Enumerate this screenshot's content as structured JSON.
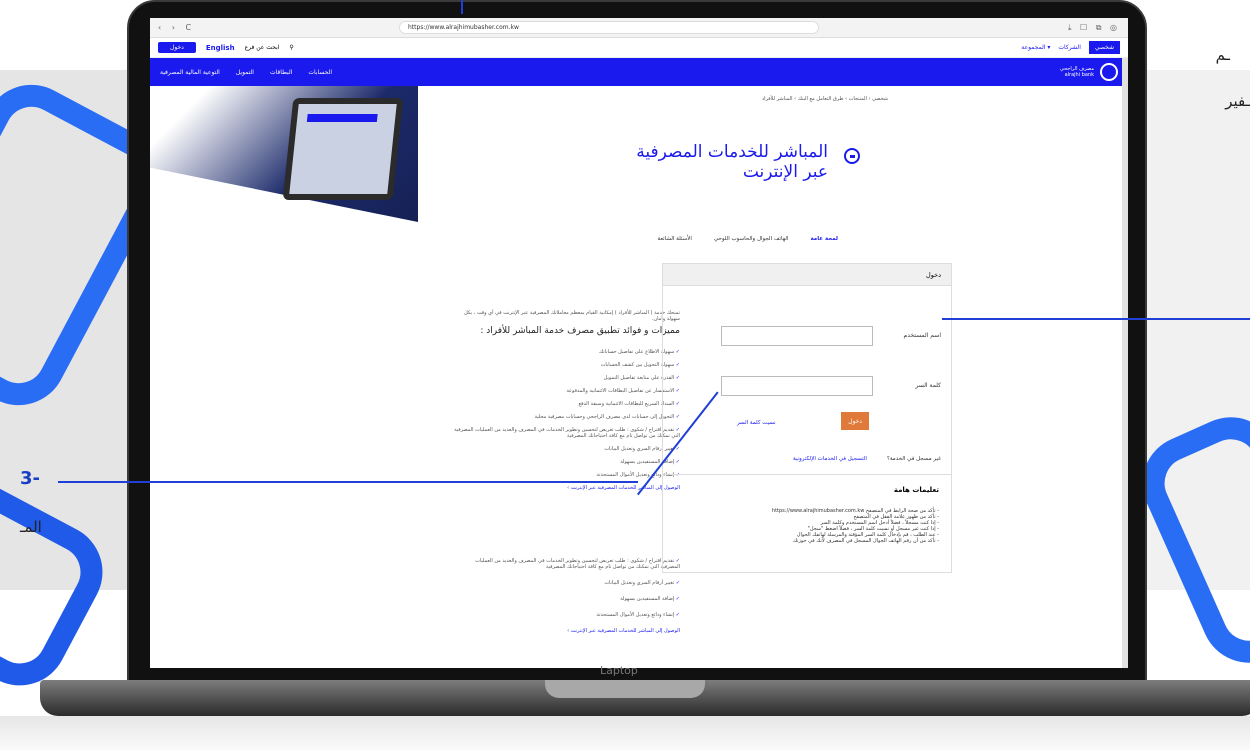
{
  "browser": {
    "url": "https://www.alrajhimubasher.com.kw",
    "nav_glyphs": "‹ › C",
    "tools_glyphs": "⤓ ☐ ⧉ ◎"
  },
  "utility_bar": {
    "login": "دخول",
    "language": "English",
    "find_branch": "ابحث عن فرع",
    "tab_personal": "شخصي",
    "tab_business": "الشركات",
    "tab_group": "المجموعة ▾"
  },
  "main_nav": {
    "links": [
      "الحسابات",
      "البطاقات",
      "التمويل",
      "التوعية المالية المصرفية"
    ],
    "brand_ar": "مصرف الراجحي",
    "brand_en": "alrajhi bank"
  },
  "breadcrumb": "شخصي  ›  المنتجات  ›  طرق التعامل مع البنك  ›  المباشر للأفراد",
  "page_title": "المباشر للخدمات المصرفية عبر الإنترنت",
  "tabs": [
    "لمحة عامة",
    "الهاتف الجوال والحاسوب اللوحي",
    "الأسئلة الشائعة"
  ],
  "login_card": {
    "heading": "دخول",
    "username_label": "اسم المستخدم",
    "password_label": "كلمة السر",
    "submit": "دخول",
    "forgot": "نسيت كلمة السر",
    "not_registered": "غير مسجل في الخدمة؟",
    "register_link": "التسجيل في الخدمات الإلكترونية",
    "notes_title": "تعليمات هامة",
    "notes": "- تأكد من صحة الرابط في المتصفح https://www.alrajhimubasher.com.kw\n- تأكد من ظهور علامة القفل في المتصفح\n- إذا كنت مسجلاً ، فضلاً أدخل اسم المستخدم وكلمة السر\n- إذا كنت غير مسجل أو نسيت كلمة السر ، فضلاً اضغط \"سجل\"\n- عند الطلب ، قم بإدخال كلمة السر المؤقتة والمرسلة لهاتفك الجوال\n- تأكد من أن رقم الهاتف الجوال المسجل في المصرف لأنك في حوزتك"
  },
  "features": {
    "intro": "تمنحك خدمة ( المباشر للأفراد ) إمكانية القيام بمعظم معاملاتك المصرفية عبر الإنترنت في أي وقت ، بكل سهولة وأمان.",
    "title": "مميزات و فوائد تطبيق مصرف خدمة المباشر للأفراد :",
    "items": [
      "سهولة الاطلاع على تفاصيل حساباتك",
      "سهولة التحويل بين كشف الحسابات",
      "القدرة على متابعة تفاصيل التمويل",
      "الاستفسار عن تفاصيل البطاقات الائتمانية والمدفوعة",
      "السداد السريع للبطاقات الائتمانية وسبقة الدفع",
      "التحويل إلى حسابات لدى مصرف الراجحي وحسابات مصرفية محلية",
      "تقديم اقتراح / شكوى : طلب تعريض لتحسين وتطوير الخدمات في المصرف والعديد من العمليات المصرفية التي تمكنك من تواصل تام مع كافة احتياجاتك المصرفية",
      "تغيير أرقام السري وتعديل البيانات",
      "إضافة المستفيدين بسهولة",
      "إنشاء ودائع وتعديل الأموال المستحدثة"
    ],
    "link": "الوصول إلى المباشر للخدمات المصرفية عبر الإنترنت ›"
  },
  "features_repeat": {
    "items": [
      "تقديم اقتراح / شكوى : طلب تعريض لتحسين وتطوير الخدمات في المصرف والعديد من العمليات المصرفية التي تمكنك من تواصل تام مع كافة احتياجاتك المصرفية",
      "تغيير أرقام السري وتعديل البيانات",
      "إضافة المستفيدين بسهولة",
      "إنشاء ودائع وتعديل الأموال المستحدثة"
    ],
    "link": "الوصول إلى المباشر للخدمات المصرفية عبر الإنترنت ›"
  },
  "laptop_label": "Laptop",
  "side_text": {
    "top_right_1": "ـم",
    "top_right_2": "ـفير",
    "step_number": "3-",
    "bottom_left": "المـ"
  }
}
